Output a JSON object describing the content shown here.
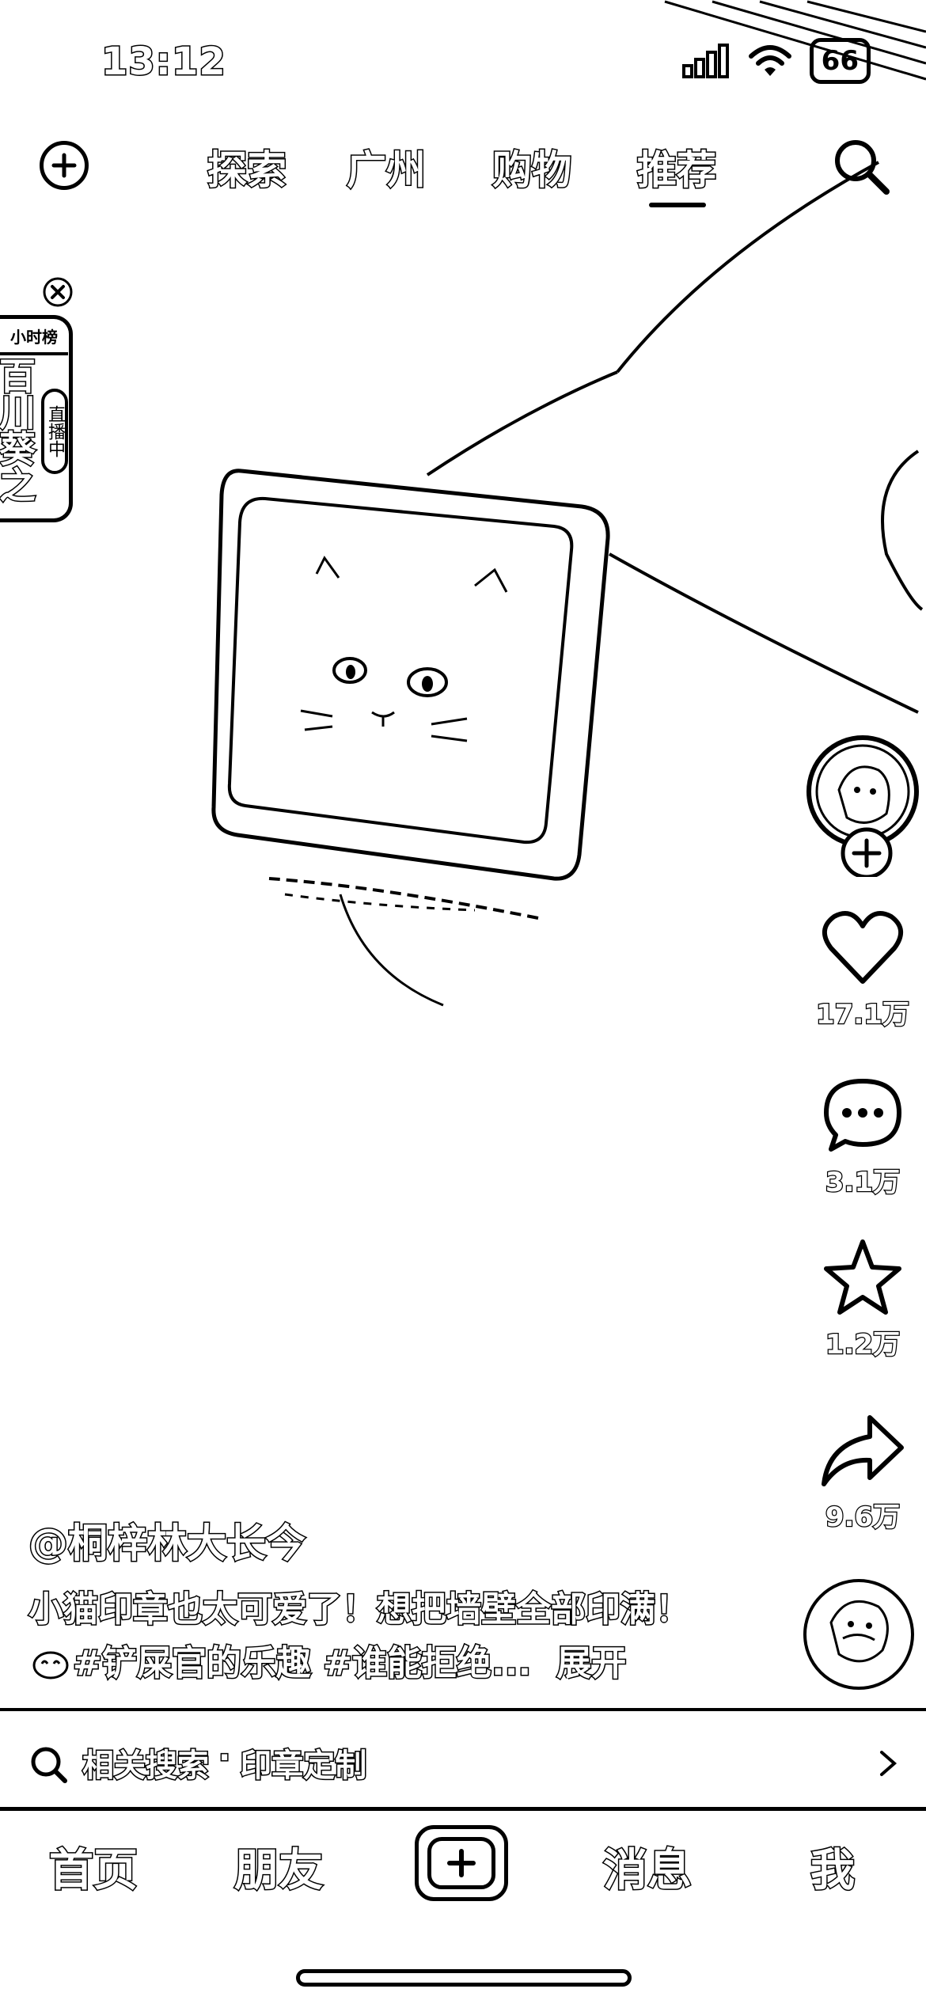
{
  "status_bar": {
    "time": "13:12",
    "battery": "66",
    "icons": [
      "signal-icon",
      "wifi-icon",
      "battery-icon"
    ]
  },
  "top_nav": {
    "tabs": [
      {
        "label": "探索",
        "active": false
      },
      {
        "label": "广州",
        "active": false
      },
      {
        "label": "购物",
        "active": false
      },
      {
        "label": "推荐",
        "active": true
      }
    ],
    "left_icon": "add-circle-icon",
    "right_icon": "search-icon"
  },
  "live_badge": {
    "top_label": "小时榜",
    "title": "百川葵之季",
    "status": "直播中"
  },
  "actions": {
    "like_count": "17.1万",
    "comment_count": "3.1万",
    "favorite_count": "1.2万",
    "share_count": "9.6万"
  },
  "post": {
    "username": "@桐梓林大长今",
    "caption_text": "小猫印章也太可爱了！想把墙壁全部印满！",
    "hashtags": "#铲屎官的乐趣 #谁能拒绝...",
    "expand_label": "展开"
  },
  "related_search": {
    "label": "相关搜索",
    "separator": "·",
    "term": "印章定制"
  },
  "tab_bar": {
    "items": [
      {
        "label": "首页"
      },
      {
        "label": "朋友"
      },
      {
        "label": "消息"
      },
      {
        "label": "我"
      }
    ]
  }
}
